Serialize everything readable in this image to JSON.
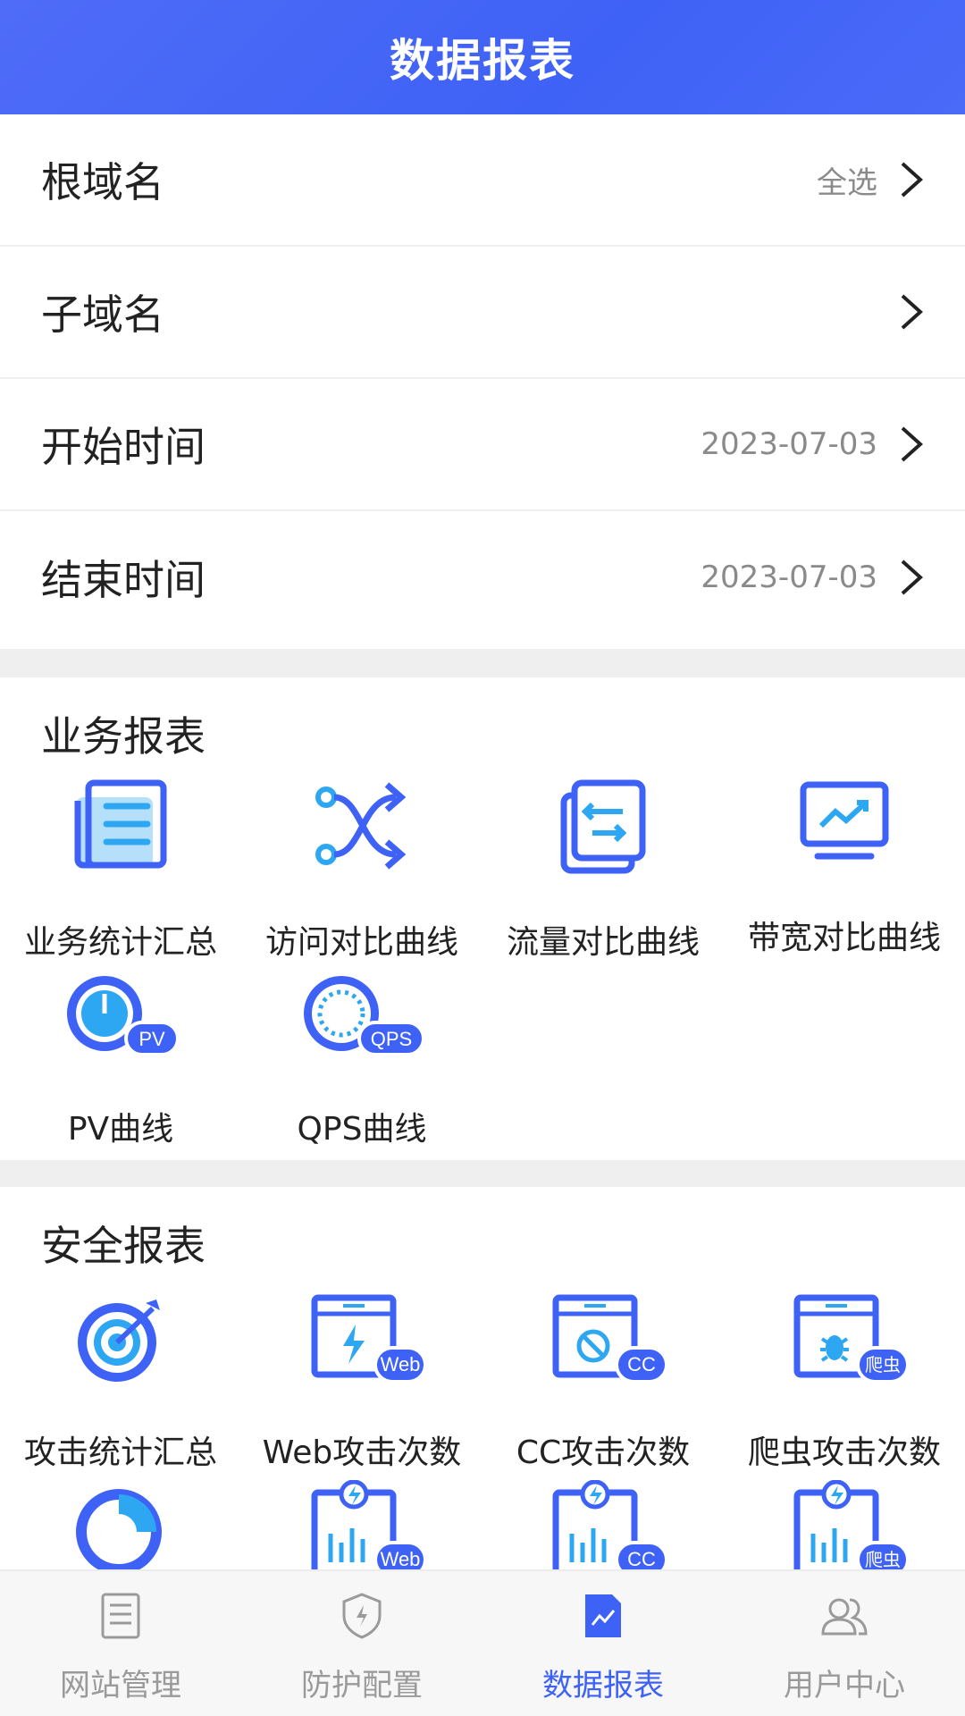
{
  "header": {
    "title": "数据报表"
  },
  "filters": [
    {
      "label": "根域名",
      "value": "全选"
    },
    {
      "label": "子域名",
      "value": ""
    },
    {
      "label": "开始时间",
      "value": "2023-07-03"
    },
    {
      "label": "结束时间",
      "value": "2023-07-03"
    }
  ],
  "business": {
    "title": "业务报表",
    "items": [
      {
        "label": "业务统计汇总",
        "icon": "document-list-icon"
      },
      {
        "label": "访问对比曲线",
        "icon": "shuffle-arrows-icon"
      },
      {
        "label": "流量对比曲线",
        "icon": "transfer-icon"
      },
      {
        "label": "带宽对比曲线",
        "icon": "monitor-trend-icon"
      },
      {
        "label": "PV曲线",
        "icon": "pv-gauge-icon",
        "badge": "PV"
      },
      {
        "label": "QPS曲线",
        "icon": "qps-gauge-icon",
        "badge": "QPS"
      }
    ]
  },
  "security": {
    "title": "安全报表",
    "items": [
      {
        "label": "攻击统计汇总",
        "icon": "target-icon"
      },
      {
        "label": "Web攻击次数",
        "icon": "web-attack-window-icon",
        "badge": "Web"
      },
      {
        "label": "CC攻击次数",
        "icon": "cc-attack-window-icon",
        "badge": "CC"
      },
      {
        "label": "爬虫攻击次数",
        "icon": "crawler-window-icon",
        "badge": "爬虫"
      },
      {
        "label": "",
        "icon": "pie-chart-icon"
      },
      {
        "label": "",
        "icon": "web-bar-chart-icon",
        "badge": "Web"
      },
      {
        "label": "",
        "icon": "cc-bar-chart-icon",
        "badge": "CC"
      },
      {
        "label": "",
        "icon": "crawler-bar-chart-icon",
        "badge": "爬虫"
      }
    ]
  },
  "nav": [
    {
      "label": "网站管理",
      "icon": "website-doc-icon"
    },
    {
      "label": "防护配置",
      "icon": "shield-icon"
    },
    {
      "label": "数据报表",
      "icon": "report-chart-icon",
      "active": true
    },
    {
      "label": "用户中心",
      "icon": "users-icon"
    }
  ],
  "colors": {
    "accent": "#3f62f6",
    "iconLight": "#2ea7f2",
    "divider": "#efefef"
  }
}
